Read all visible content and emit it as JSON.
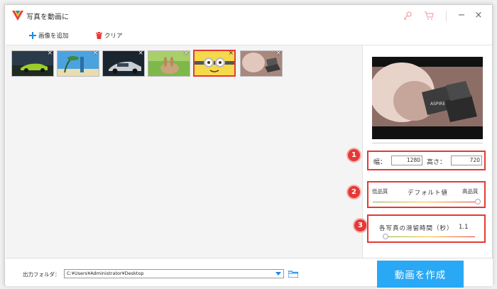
{
  "window": {
    "title": "写真を動画に"
  },
  "toolbar": {
    "add_label": "画像を追加",
    "clear_label": "クリア"
  },
  "settings": {
    "width_label": "幅：",
    "width_value": "1280",
    "height_label": "高さ：",
    "height_value": "720",
    "quality_low": "低品質",
    "quality_default": "デフォルト値",
    "quality_high": "高品質",
    "quality_level": 1.0,
    "duration_label": "各写真の滞留時間（秒）",
    "duration_value": "1.1",
    "duration_level": 0.03
  },
  "badges": [
    "1",
    "2",
    "3"
  ],
  "output": {
    "folder_label": "出力フォルダ：",
    "folder_path": "C:¥Users¥Administrator¥Desktop"
  },
  "create_button": "動画を作成",
  "colors": {
    "accent": "#29a8f5",
    "highlight": "#e53935",
    "plus": "#1e88e5"
  }
}
